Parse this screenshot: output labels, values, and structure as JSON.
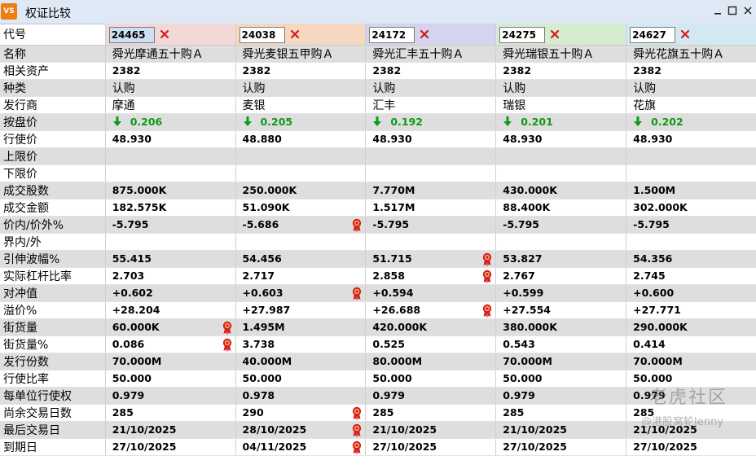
{
  "window": {
    "title": "权证比较",
    "app_icon_text": "VS"
  },
  "columns": [
    {
      "code": "24465",
      "header_color": "#f3d8d8",
      "selected": true
    },
    {
      "code": "24038",
      "header_color": "#f5d8bf",
      "selected": false
    },
    {
      "code": "24172",
      "header_color": "#d5d4f0",
      "selected": false
    },
    {
      "code": "24275",
      "header_color": "#d5ecd0",
      "selected": false
    },
    {
      "code": "24627",
      "header_color": "#d2e9f3",
      "selected": false
    }
  ],
  "rows": [
    {
      "label": "名称",
      "type": "cn",
      "values": [
        "舜光摩通五十购Ａ",
        "舜光麦银五甲购Ａ",
        "舜光汇丰五十购Ａ",
        "舜光瑞银五十购Ａ",
        "舜光花旗五十购Ａ"
      ]
    },
    {
      "label": "相关资产",
      "type": "num",
      "values": [
        "2382",
        "2382",
        "2382",
        "2382",
        "2382"
      ]
    },
    {
      "label": "种类",
      "type": "cn",
      "values": [
        "认购",
        "认购",
        "认购",
        "认购",
        "认购"
      ]
    },
    {
      "label": "发行商",
      "type": "cn",
      "values": [
        "摩通",
        "麦银",
        "汇丰",
        "瑞银",
        "花旗"
      ]
    },
    {
      "label": "按盘价",
      "type": "price",
      "values": [
        "0.206",
        "0.205",
        "0.192",
        "0.201",
        "0.202"
      ]
    },
    {
      "label": "行使价",
      "type": "num",
      "values": [
        "48.930",
        "48.880",
        "48.930",
        "48.930",
        "48.930"
      ]
    },
    {
      "label": "上限价",
      "type": "num",
      "values": [
        "",
        "",
        "",
        "",
        ""
      ]
    },
    {
      "label": "下限价",
      "type": "num",
      "values": [
        "",
        "",
        "",
        "",
        ""
      ]
    },
    {
      "label": "成交股数",
      "type": "num",
      "values": [
        "875.000K",
        "250.000K",
        "7.770M",
        "430.000K",
        "1.500M"
      ]
    },
    {
      "label": "成交金额",
      "type": "num",
      "values": [
        "182.575K",
        "51.090K",
        "1.517M",
        "88.400K",
        "302.000K"
      ]
    },
    {
      "label": "价内/价外%",
      "type": "num",
      "values": [
        "-5.795",
        "-5.686",
        "-5.795",
        "-5.795",
        "-5.795"
      ],
      "medals": [
        1
      ]
    },
    {
      "label": "界内/外",
      "type": "num",
      "values": [
        "",
        "",
        "",
        "",
        ""
      ]
    },
    {
      "label": "引伸波幅%",
      "type": "num",
      "values": [
        "55.415",
        "54.456",
        "51.715",
        "53.827",
        "54.356"
      ],
      "medals": [
        2
      ]
    },
    {
      "label": "实际杠杆比率",
      "type": "num",
      "values": [
        "2.703",
        "2.717",
        "2.858",
        "2.767",
        "2.745"
      ],
      "medals": [
        2
      ]
    },
    {
      "label": "对冲值",
      "type": "num",
      "values": [
        "+0.602",
        "+0.603",
        "+0.594",
        "+0.599",
        "+0.600"
      ],
      "medals": [
        1
      ]
    },
    {
      "label": "溢价%",
      "type": "num",
      "values": [
        "+28.204",
        "+27.987",
        "+26.688",
        "+27.554",
        "+27.771"
      ],
      "medals": [
        2
      ]
    },
    {
      "label": "街货量",
      "type": "num",
      "values": [
        "60.000K",
        "1.495M",
        "420.000K",
        "380.000K",
        "290.000K"
      ],
      "medals": [
        0
      ]
    },
    {
      "label": "街货量%",
      "type": "num",
      "values": [
        "0.086",
        "3.738",
        "0.525",
        "0.543",
        "0.414"
      ],
      "medals": [
        0
      ]
    },
    {
      "label": "发行份数",
      "type": "num",
      "values": [
        "70.000M",
        "40.000M",
        "80.000M",
        "70.000M",
        "70.000M"
      ]
    },
    {
      "label": "行使比率",
      "type": "num",
      "values": [
        "50.000",
        "50.000",
        "50.000",
        "50.000",
        "50.000"
      ]
    },
    {
      "label": "每单位行使权",
      "type": "num",
      "values": [
        "0.979",
        "0.978",
        "0.979",
        "0.979",
        "0.979"
      ]
    },
    {
      "label": "尚余交易日数",
      "type": "num",
      "values": [
        "285",
        "290",
        "285",
        "285",
        "285"
      ],
      "medals": [
        1
      ]
    },
    {
      "label": "最后交易日",
      "type": "num",
      "values": [
        "21/10/2025",
        "28/10/2025",
        "21/10/2025",
        "21/10/2025",
        "21/10/2025"
      ],
      "medals": [
        1
      ]
    },
    {
      "label": "到期日",
      "type": "num",
      "values": [
        "27/10/2025",
        "04/11/2025",
        "27/10/2025",
        "27/10/2025",
        "27/10/2025"
      ],
      "medals": [
        1
      ]
    }
  ],
  "code_label": "代号",
  "watermark": {
    "logo_text": "老虎社区",
    "handle": "@港股窝轮Jenny"
  },
  "colors": {
    "price_green": "#0c9a17",
    "remove_red": "#d11b1b",
    "medal_red": "#d61f1f"
  }
}
